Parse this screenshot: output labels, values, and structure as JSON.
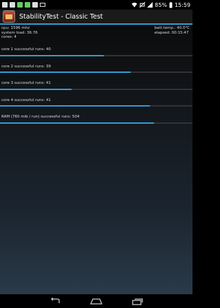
{
  "status": {
    "battery": "85%",
    "time": "15:59"
  },
  "app": {
    "title": "StabilityTest - Classic Test"
  },
  "info": {
    "cpu": "cpu: 1596 mhz",
    "system_load": "system load: 36.76",
    "cores": "cores: 4",
    "batt_temp": "batt.temp.: 40.0°C",
    "elapsed": "elapsed: 00:15:47"
  },
  "runs": [
    {
      "label": "core 1 successful runs: 40",
      "progress": 0.54
    },
    {
      "label": "core 2 successful runs: 39",
      "progress": 0.68
    },
    {
      "label": "core 3 successful runs: 41",
      "progress": 0.37
    },
    {
      "label": "core 4 successful runs: 41",
      "progress": 0.78
    },
    {
      "label": "RAM (760 mib / run) successful runs: 504",
      "progress": 0.8
    }
  ],
  "icons": {
    "status": [
      "notification-icon",
      "image-icon",
      "download-icon",
      "android-icon",
      "download-icon",
      "mail-icon",
      "wifi-icon",
      "mute-icon",
      "signal-icon",
      "battery-icon"
    ],
    "nav": [
      "back-icon",
      "home-icon",
      "recent-apps-icon"
    ]
  },
  "colors": {
    "accent": "#2f9fd6"
  }
}
